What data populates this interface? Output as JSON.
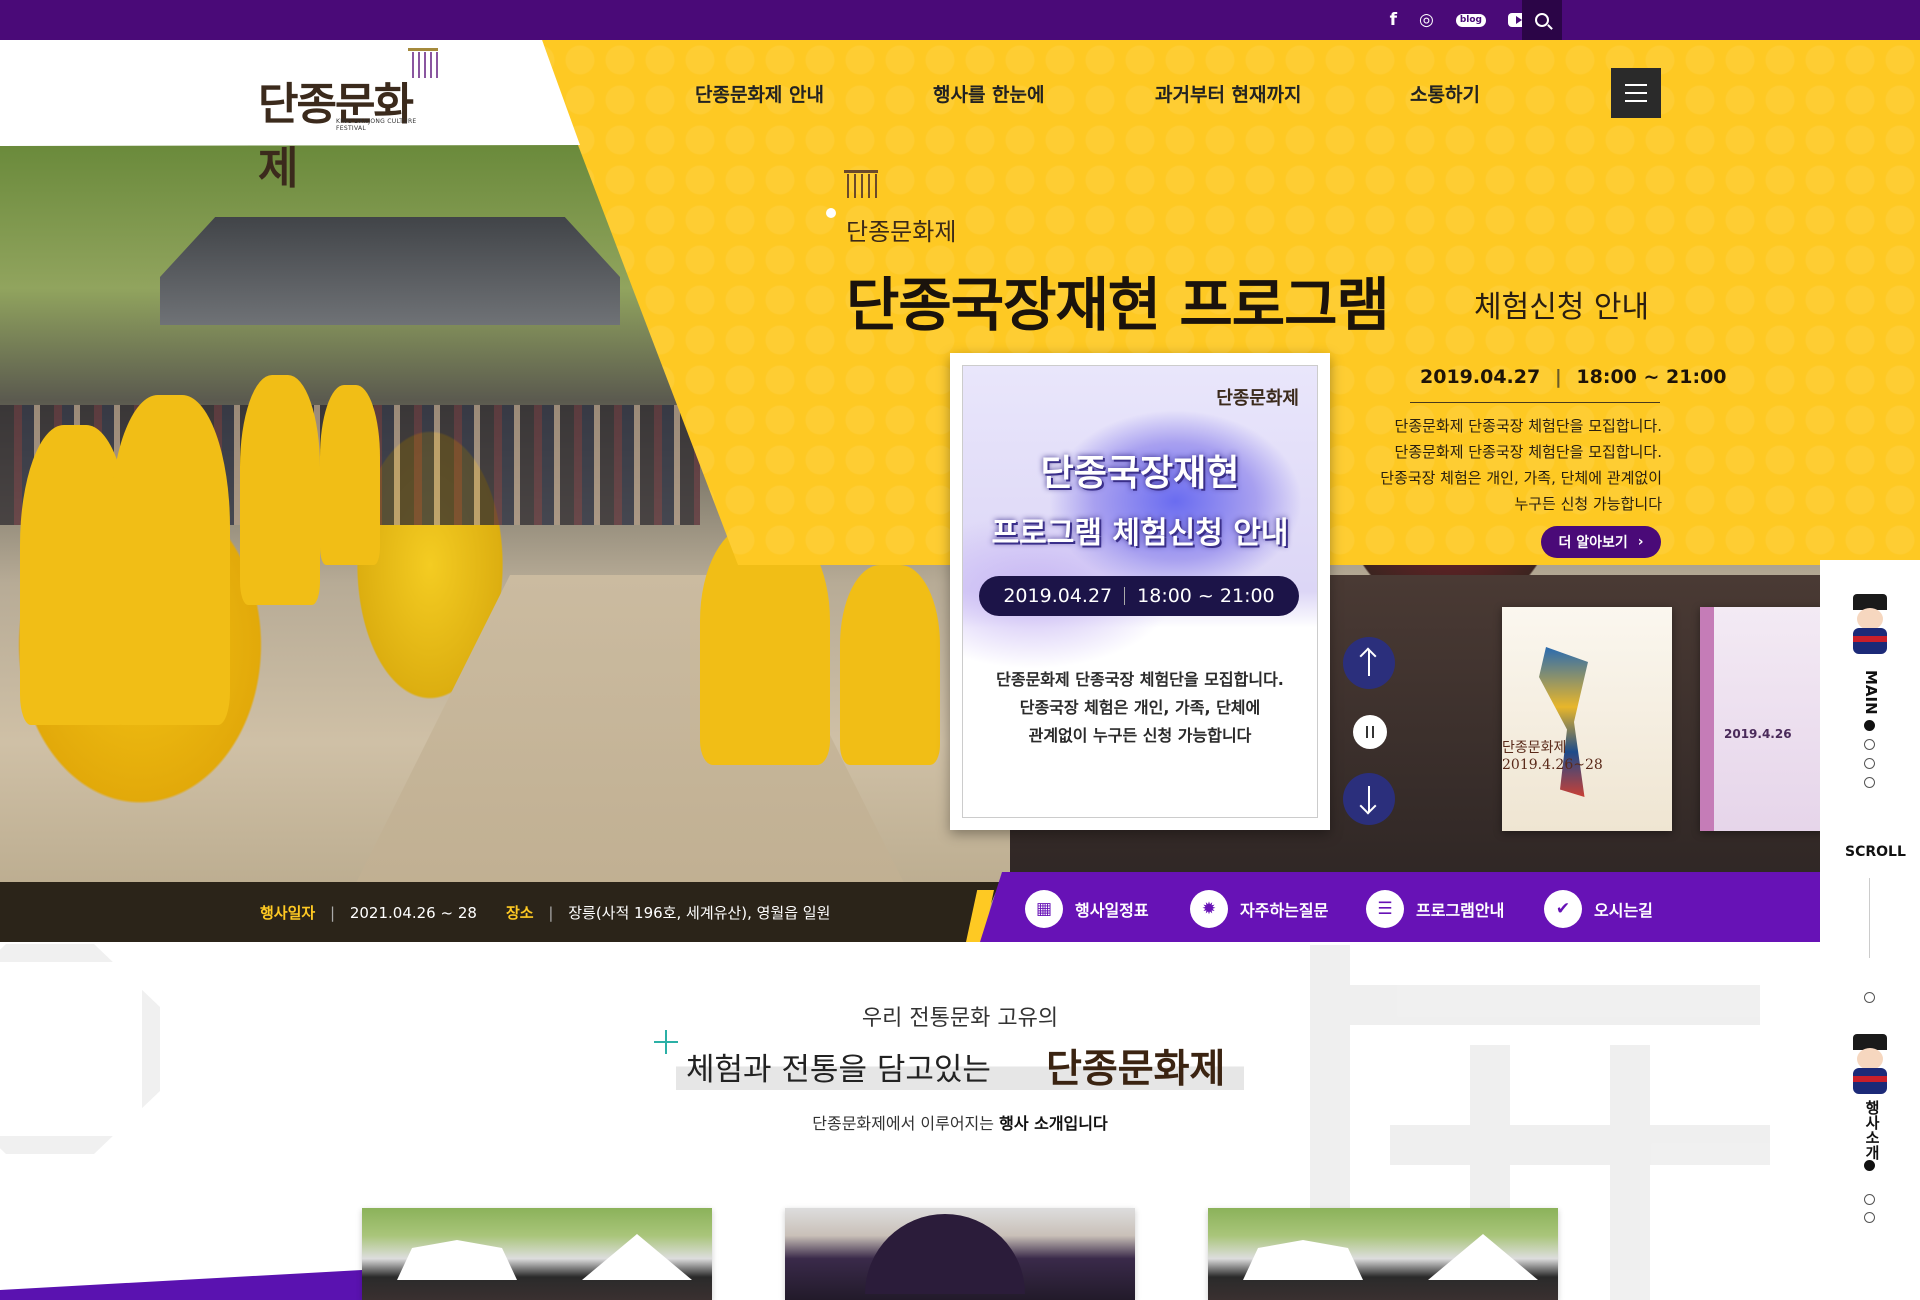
{
  "topbar": {
    "social": [
      {
        "name": "facebook-icon",
        "glyph": "f"
      },
      {
        "name": "instagram-icon",
        "glyph": "◎"
      },
      {
        "name": "blog-icon",
        "glyph": "blog"
      },
      {
        "name": "youtube-icon",
        "glyph": ""
      }
    ]
  },
  "logo": {
    "title": "단종문화제",
    "subtitle": "KING DANJONG CULTURE FESTIVAL"
  },
  "nav": {
    "items": [
      "단종문화제 안내",
      "행사를 한눈에",
      "과거부터 현재까지",
      "소통하기"
    ]
  },
  "hero": {
    "sub": "단종문화제",
    "title": "단종국장재현 프로그램",
    "title_suffix": "체험신청 안내",
    "date": "2019.04.27",
    "time": "18:00 ~ 21:00",
    "desc": [
      "단종문화제 단종국장 체험단을 모집합니다.",
      "단종문화제 단종국장 체험단을 모집합니다.",
      "단종국장 체험은 개인, 가족, 단체에 관계없이",
      "누구든 신청 가능합니다"
    ],
    "more_label": "더 알아보기"
  },
  "poster": {
    "logo": "단종문화제",
    "title1": "단종국장재현",
    "title2": "프로그램 체험신청 안내",
    "date": "2019.04.27",
    "time": "18:00 ~ 21:00",
    "body": [
      "단종문화제 단종국장 체험단을 모집합니다.",
      "단종국장 체험은 개인, 가족, 단체에",
      "관계없이 누구든 신청 가능합니다"
    ]
  },
  "thumbs": [
    {
      "label": "단종문화제 2019.4.26~28"
    },
    {
      "label": "2019.4.26"
    }
  ],
  "info": {
    "date_label": "행사일자",
    "date_value": "2021.04.26 ~ 28",
    "place_label": "장소",
    "place_value": "장릉(사적 196호, 세계유산), 영월읍 일원"
  },
  "quick": [
    {
      "label": "행사일정표",
      "icon": "calendar-icon",
      "glyph": "▦"
    },
    {
      "label": "자주하는질문",
      "icon": "lightbulb-icon",
      "glyph": "✹"
    },
    {
      "label": "프로그램안내",
      "icon": "list-icon",
      "glyph": "☰"
    },
    {
      "label": "오시는길",
      "icon": "location-icon",
      "glyph": "✔"
    }
  ],
  "rail": {
    "main_label": "MAIN",
    "scroll_label": "SCROLL",
    "intro_label": "행사소개"
  },
  "section": {
    "sub": "우리 전통문화 고유의",
    "title_a": "체험과 전통을 담고있는",
    "title_b": "단종문화제",
    "desc_a": "단종문화제에서 이루어지는",
    "desc_b": "행사 소개입니다"
  },
  "colors": {
    "purple": "#4a0a78",
    "yellow": "#fec923",
    "quick_purple": "#6712b6"
  }
}
